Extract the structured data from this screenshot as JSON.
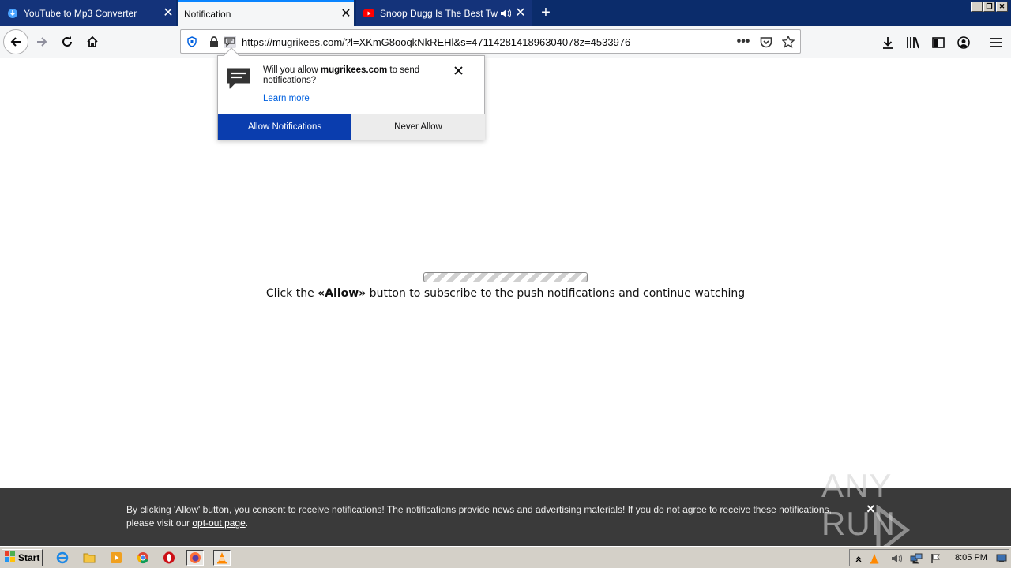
{
  "browser": {
    "tabs": [
      {
        "label": "YouTube to Mp3 Converter",
        "icon": "download-cloud-icon"
      },
      {
        "label": "Notification",
        "icon": ""
      },
      {
        "label": "Snoop Dugg Is The Best Twitch",
        "icon": "youtube-icon"
      }
    ],
    "new_tab_label": "+",
    "url": "https://mugrikees.com/?l=XKmG8ooqkNkREHl&s=4711428141896304078z=4533976",
    "window_buttons": [
      "_",
      "❐",
      "✕"
    ]
  },
  "doorhanger": {
    "message_prefix": "Will you allow ",
    "domain": "mugrikees.com",
    "message_suffix": " to send notifications?",
    "learn_more": "Learn more",
    "allow_button": "Allow Notifications",
    "never_button": "Never Allow"
  },
  "page": {
    "progress": 1.0,
    "message_prefix": "Click the ",
    "message_bold": "«Allow»",
    "message_suffix": " button to subscribe to the push notifications and continue watching"
  },
  "consent_banner": {
    "text_line1": "By clicking 'Allow' button, you consent to receive notifications! The notifications provide news and advertising materials! If you do not agree to receive these notifications,",
    "text_line2_prefix": "please visit our ",
    "link_text": "opt-out page",
    "text_line2_suffix": ".",
    "close_label": "×"
  },
  "watermark": {
    "text": "ANY RUN"
  },
  "taskbar": {
    "start_label": "Start",
    "clock": "8:05 PM"
  },
  "colors": {
    "tabstrip": "#0b2c6b",
    "allow_button": "#0a3dae",
    "banner": "#3a3a3a",
    "taskbar": "#d4d0c8"
  }
}
